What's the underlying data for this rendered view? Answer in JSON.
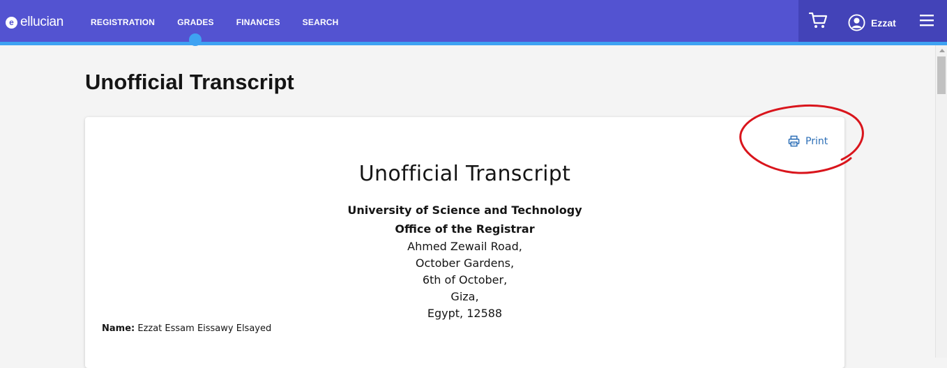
{
  "header": {
    "logo_text": "ellucian",
    "nav": [
      {
        "label": "REGISTRATION"
      },
      {
        "label": "GRADES",
        "active": true
      },
      {
        "label": "FINANCES"
      },
      {
        "label": "SEARCH"
      }
    ],
    "user_name": "Ezzat",
    "icons": [
      "cart-icon",
      "user-icon",
      "menu-icon"
    ]
  },
  "page": {
    "title": "Unofficial Transcript"
  },
  "transcript": {
    "print_label": "Print",
    "title": "Unofficial Transcript",
    "institution": "University of Science and Technology",
    "office": "Office of the Registrar",
    "address_lines": [
      "Ahmed Zewail Road,",
      "October Gardens,",
      "6th of October,",
      "Giza,",
      "Egypt, 12588"
    ],
    "name_label": "Name:",
    "name_value": "Ezzat Essam Eissawy Elsayed"
  },
  "colors": {
    "header_bg": "#5353d1",
    "header_right_bg": "#4343b8",
    "accent": "#3ea2f2",
    "link": "#2d6fb7",
    "annotation": "#d9151c"
  }
}
